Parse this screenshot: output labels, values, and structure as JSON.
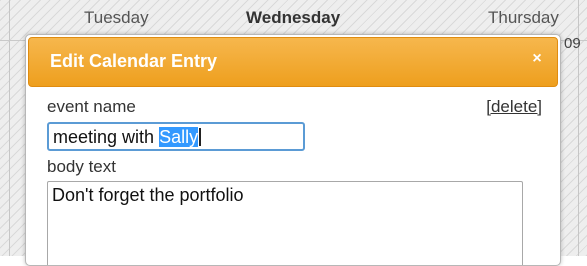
{
  "calendar": {
    "days": [
      "Tuesday",
      "Wednesday",
      "Thursday"
    ],
    "date_fragment": "09"
  },
  "dialog": {
    "title": "Edit Calendar Entry",
    "close_glyph": "×",
    "event_name_label": "event name",
    "delete_label": "[delete]",
    "event_name_value_prefix": "meeting with ",
    "event_name_value_selected": "Sally",
    "body_text_label": "body text",
    "body_text_value": "Don't forget the portfolio"
  },
  "colors": {
    "titlebar": "#F0A52A",
    "selection": "#3399FF",
    "focus_border": "#5B9BD5"
  }
}
